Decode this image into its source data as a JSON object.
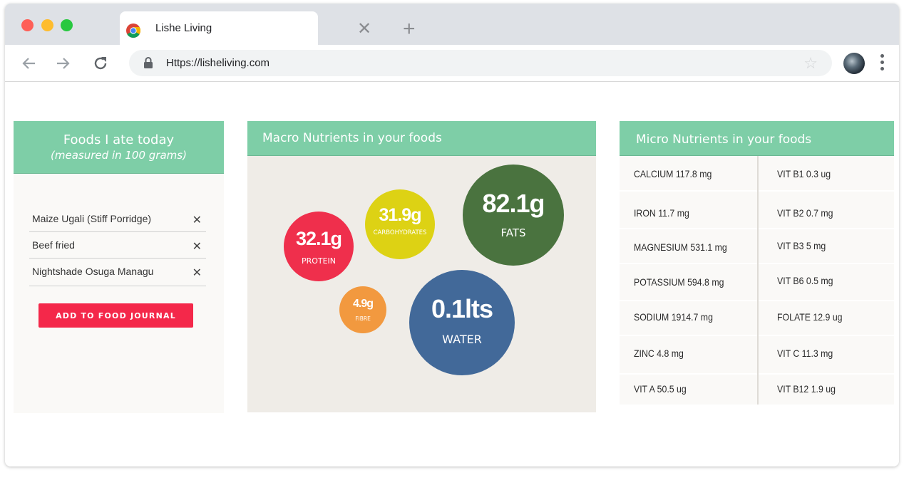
{
  "browser": {
    "tab_title": "Lishe Living",
    "url": "Https://lisheliving.com",
    "tab_close_symbol": "✕",
    "new_tab_symbol": "+"
  },
  "foods_panel": {
    "title": "Foods I ate today",
    "subtitle": "(measured in 100 grams)",
    "items": [
      {
        "name": "Maize Ugali (Stiff Porridge)"
      },
      {
        "name": "Beef fried"
      },
      {
        "name": "Nightshade Osuga Managu"
      }
    ],
    "remove_symbol": "✕",
    "add_button": "ADD TO FOOD JOURNAL"
  },
  "macro_panel": {
    "title": "Macro Nutrients in your foods",
    "nutrients": {
      "protein": {
        "value": "32.1g",
        "label": "PROTEIN",
        "color": "#ef2f4c"
      },
      "carbohydrates": {
        "value": "31.9g",
        "label": "CARBOHYDRATES",
        "color": "#ddd214"
      },
      "fats": {
        "value": "82.1g",
        "label": "FATS",
        "color": "#4a733f"
      },
      "fibre": {
        "value": "4.9g",
        "label": "FIBRE",
        "color": "#f2993f"
      },
      "water": {
        "value": "0.1lts",
        "label": "WATER",
        "color": "#426999"
      }
    }
  },
  "micro_panel": {
    "title": "Micro Nutrients in your foods",
    "rows": [
      {
        "left": "CALCIUM 117.8 mg",
        "right": "VIT B1 0.3 ug"
      },
      {
        "left": "IRON 11.7 mg",
        "right": "VIT B2 0.7  mg"
      },
      {
        "left": "MAGNESIUM 531.1 mg",
        "right": "VIT B3 5 mg"
      },
      {
        "left": "POTASSIUM 594.8 mg",
        "right": "VIT B6 0.5 mg"
      },
      {
        "left": "SODIUM 1914.7 mg",
        "right": "FOLATE 12.9 ug"
      },
      {
        "left": "ZINC 4.8 mg",
        "right": "VIT C  11.3 mg"
      },
      {
        "left": "VIT A 50.5 ug",
        "right": "VIT B12 1.9 ug"
      }
    ]
  },
  "colors": {
    "accent_green": "#7ecea7",
    "button_red": "#f4284a"
  }
}
